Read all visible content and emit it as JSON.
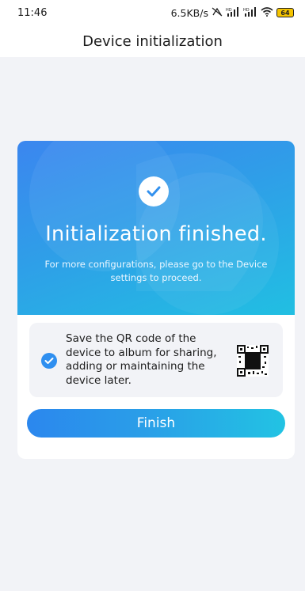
{
  "status_bar": {
    "time": "11:46",
    "network_speed": "6.5KB/s",
    "battery_level": "64",
    "icons": [
      "no-sync-icon",
      "signal-hd-icon",
      "signal-hd-icon",
      "wifi-icon",
      "battery-icon"
    ]
  },
  "header": {
    "title": "Device initialization"
  },
  "banner": {
    "title": "Initialization finished.",
    "subtitle": "For more configurations, please go to the Device settings to proceed.",
    "icon": "check-circle-icon"
  },
  "qr_option": {
    "checked": true,
    "label": "Save the QR code of the device to album for sharing, adding or maintaining the device later.",
    "icon": "qr-code-icon"
  },
  "actions": {
    "finish_label": "Finish"
  },
  "colors": {
    "accent": "#2f8ff0",
    "banner_start": "#3b86ef",
    "banner_end": "#21bfe2",
    "background": "#f2f3f7"
  }
}
